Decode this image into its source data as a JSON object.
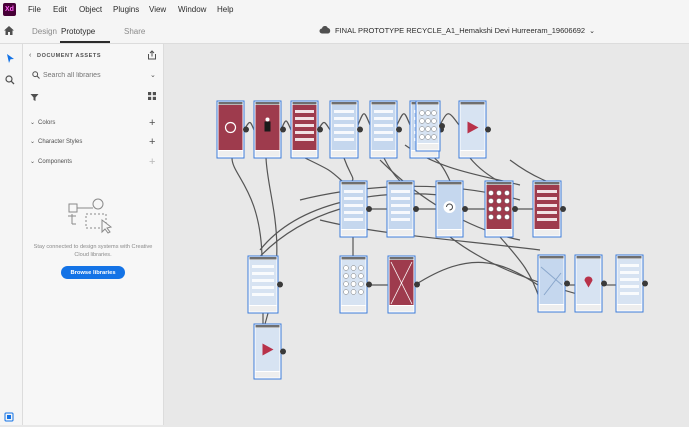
{
  "app": {
    "logo_text": "Xd"
  },
  "menu": [
    "File",
    "Edit",
    "Object",
    "Plugins",
    "View",
    "Window",
    "Help"
  ],
  "modes": [
    {
      "label": "Design"
    },
    {
      "label": "Prototype",
      "active": true
    },
    {
      "label": "Share"
    }
  ],
  "document": {
    "title": "FINAL PROTOTYPE RECYCLE_A1_Hemakshi Devi Hurreeram_19606692"
  },
  "panel": {
    "title": "DOCUMENT ASSETS",
    "search_placeholder": "Search all libraries",
    "sections": [
      {
        "label": "Colors"
      },
      {
        "label": "Character Styles"
      },
      {
        "label": "Components"
      }
    ],
    "empty_message": "Stay connected to design systems with Creative Cloud libraries.",
    "browse_label": "Browse libraries"
  },
  "colors": {
    "accent": "#1473e6",
    "artboard_fill": "#9e3b4d",
    "wire_color": "#555555",
    "selection": "#3d7bd9"
  },
  "icons": [
    "home-icon",
    "select-tool-icon",
    "zoom-tool-icon",
    "back-chevron-icon",
    "share-icon",
    "search-icon",
    "filter-icon",
    "grid-view-icon",
    "cloud-icon",
    "help-icon"
  ],
  "artboards": [
    {
      "fill": "#9e3b4d",
      "motif": "circle"
    },
    {
      "fill": "#9e3b4d",
      "motif": "figure"
    },
    {
      "fill": "#9e3b4d",
      "motif": "list"
    },
    {
      "fill": "#c5d7ee",
      "motif": "list"
    },
    {
      "fill": "#c5d7ee",
      "motif": "list"
    },
    {
      "fill": "#c5d7ee",
      "motif": "list"
    },
    {
      "fill": "#d7e3f2",
      "motif": "keypad"
    },
    {
      "fill": "#d7e3f2",
      "motif": "play"
    },
    {
      "fill": "#c5d7ee",
      "motif": "form"
    },
    {
      "fill": "#c5d7ee",
      "motif": "form"
    },
    {
      "fill": "#c5d7ee",
      "motif": "refresh"
    },
    {
      "fill": "#9e3b4d",
      "motif": "keypad"
    },
    {
      "fill": "#9e3b4d",
      "motif": "list"
    },
    {
      "fill": "#d7e3f2",
      "motif": "form"
    },
    {
      "fill": "#d7e3f2",
      "motif": "keypad"
    },
    {
      "fill": "#9e3b4d",
      "motif": "cross"
    },
    {
      "fill": "#c5d7ee",
      "motif": "map"
    },
    {
      "fill": "#d7e3f2",
      "motif": "pin"
    },
    {
      "fill": "#d7e3f2",
      "motif": "form"
    },
    {
      "fill": "#d7e3f2",
      "motif": "play"
    }
  ]
}
